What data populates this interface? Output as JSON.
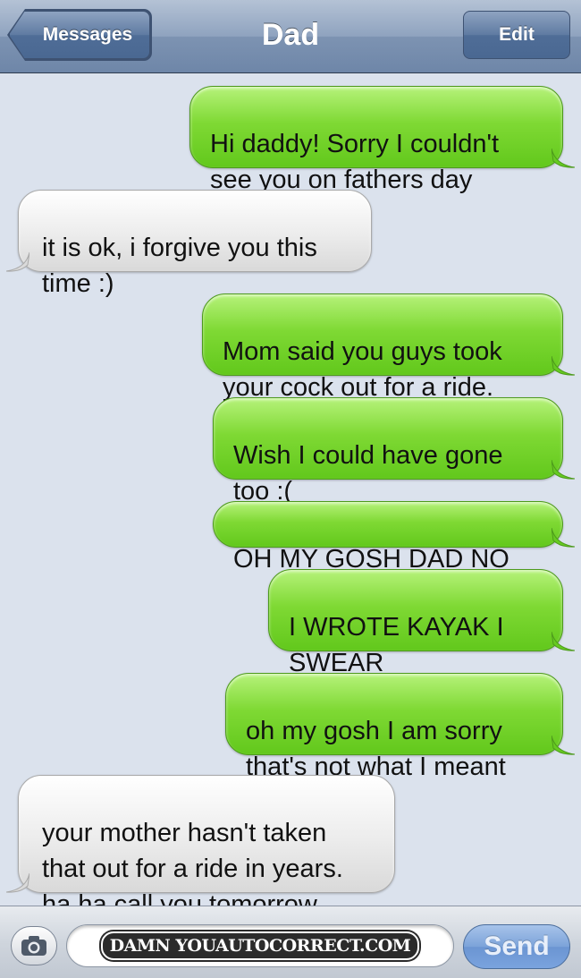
{
  "header": {
    "back_label": "Messages",
    "title": "Dad",
    "edit_label": "Edit"
  },
  "messages": [
    {
      "from": "me",
      "text": "Hi daddy! Sorry I couldn't\nsee you on fathers day"
    },
    {
      "from": "dad",
      "text": "it is ok, i forgive you this\ntime :)"
    },
    {
      "from": "me",
      "text": "Mom said you guys took\nyour cock out for a ride."
    },
    {
      "from": "me",
      "text": "Wish I could have gone\ntoo :("
    },
    {
      "from": "me",
      "text": "OH MY GOSH DAD NO"
    },
    {
      "from": "me",
      "text": "I WROTE KAYAK I\nSWEAR"
    },
    {
      "from": "me",
      "text": "oh my gosh I am sorry\nthat's not what I meant"
    },
    {
      "from": "dad",
      "text": "your mother hasn't taken\nthat out for a ride in years.\nha ha call you tomorrow"
    }
  ],
  "input_bar": {
    "camera_icon": "camera-icon",
    "field_watermark": "DAMN YOUAUTOCORRECT.COM",
    "send_label": "Send"
  },
  "colors": {
    "sent_bubble": "#7fd934",
    "received_bubble": "#ececec",
    "background": "#dbe2ed",
    "nav_bar": "#7d93b2"
  }
}
